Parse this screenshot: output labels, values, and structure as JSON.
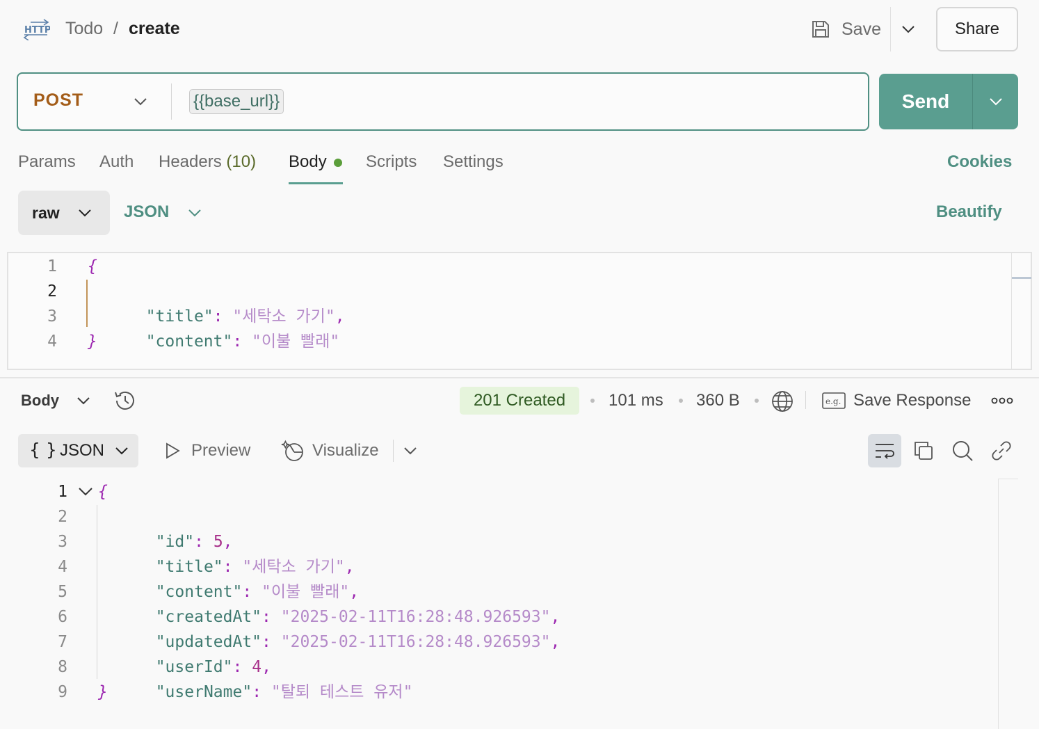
{
  "header": {
    "icon": "http-icon",
    "breadcrumb_parent": "Todo",
    "breadcrumb_separator": "/",
    "breadcrumb_current": "create",
    "save_label": "Save",
    "share_label": "Share"
  },
  "request": {
    "method": "POST",
    "url_variable": "{{base_url}}",
    "send_label": "Send"
  },
  "tabs": {
    "params": "Params",
    "auth": "Auth",
    "headers": "Headers",
    "headers_count": "(10)",
    "body": "Body",
    "scripts": "Scripts",
    "settings": "Settings",
    "cookies": "Cookies",
    "active": "Body"
  },
  "body_mode": {
    "mode": "raw",
    "language": "JSON",
    "beautify": "Beautify"
  },
  "request_body": {
    "line_numbers": [
      "1",
      "2",
      "3",
      "4"
    ],
    "open_brace": "{",
    "close_brace": "}",
    "lines": [
      {
        "key": "\"title\"",
        "colon": ":",
        "value": "\"세탁소 가기\"",
        "trail": ","
      },
      {
        "key": "\"content\"",
        "colon": ":",
        "value": "\"이불 빨래\"",
        "trail": ""
      }
    ]
  },
  "response": {
    "body_label": "Body",
    "status": "201 Created",
    "time": "101 ms",
    "size": "360 B",
    "save_response": "Save Response",
    "format_braces": "{ }",
    "format_label": "JSON",
    "preview_label": "Preview",
    "visualize_label": "Visualize",
    "line_numbers": [
      "1",
      "2",
      "3",
      "4",
      "5",
      "6",
      "7",
      "8",
      "9"
    ],
    "open_brace": "{",
    "close_brace": "}",
    "lines": [
      {
        "key": "\"id\"",
        "colon": ":",
        "value": "5",
        "trail": ","
      },
      {
        "key": "\"title\"",
        "colon": ":",
        "value": "\"세탁소 가기\"",
        "trail": ","
      },
      {
        "key": "\"content\"",
        "colon": ":",
        "value": "\"이불 빨래\"",
        "trail": ","
      },
      {
        "key": "\"createdAt\"",
        "colon": ":",
        "value": "\"2025-02-11T16:28:48.926593\"",
        "trail": ","
      },
      {
        "key": "\"updatedAt\"",
        "colon": ":",
        "value": "\"2025-02-11T16:28:48.926593\"",
        "trail": ","
      },
      {
        "key": "\"userId\"",
        "colon": ":",
        "value": "4",
        "trail": ","
      },
      {
        "key": "\"userName\"",
        "colon": ":",
        "value": "\"탈퇴 테스트 유저\"",
        "trail": ""
      }
    ]
  },
  "colors": {
    "accent": "#5a9e90",
    "method": "#a35c18",
    "status_bg": "#e6f4dc",
    "json_key": "#3f7a70",
    "json_string": "#b58ac9",
    "json_number": "#a8308a"
  }
}
